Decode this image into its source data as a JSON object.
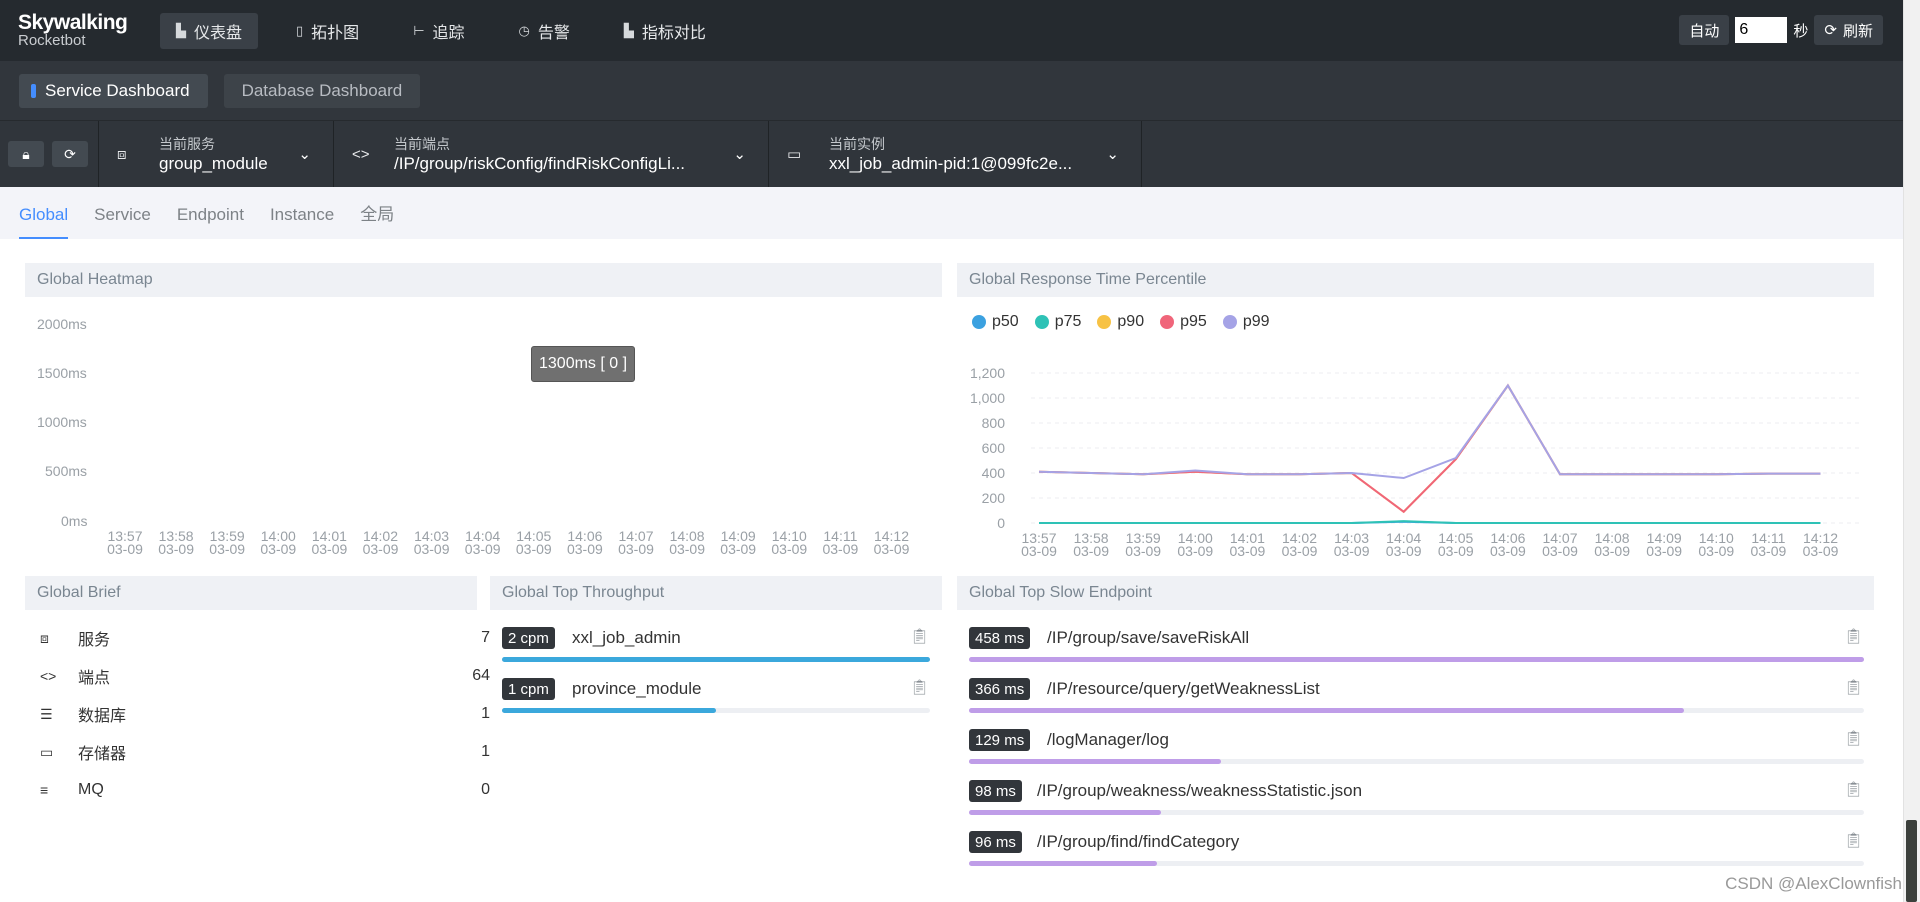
{
  "app": {
    "logo_line1": "Skywalking",
    "logo_line2": "Rocketbot"
  },
  "nav": [
    {
      "icon": "chart-icon",
      "label": "仪表盘",
      "active": true
    },
    {
      "icon": "topology-icon",
      "label": "拓扑图"
    },
    {
      "icon": "trace-icon",
      "label": "追踪"
    },
    {
      "icon": "alarm-icon",
      "label": "告警"
    },
    {
      "icon": "compare-icon",
      "label": "指标对比"
    }
  ],
  "topright": {
    "auto_label": "自动",
    "interval_value": "6",
    "sec_label": "秒",
    "refresh_label": "刷新"
  },
  "dashboards": [
    "Service Dashboard",
    "Database Dashboard"
  ],
  "selectors": {
    "service": {
      "label": "当前服务",
      "value": "group_module"
    },
    "endpoint": {
      "label": "当前端点",
      "value": "/IP/group/riskConfig/findRiskConfigLi..."
    },
    "instance": {
      "label": "当前实例",
      "value": "xxl_job_admin-pid:1@099fc2e..."
    }
  },
  "subtabs": [
    "Global",
    "Service",
    "Endpoint",
    "Instance",
    "全局"
  ],
  "heatmap": {
    "title": "Global Heatmap",
    "y_labels": [
      "2000ms",
      "1500ms",
      "1000ms",
      "500ms",
      "0ms"
    ],
    "tooltip": "1300ms [ 0 ]"
  },
  "time_labels": [
    "13:57",
    "13:58",
    "13:59",
    "14:00",
    "14:01",
    "14:02",
    "14:03",
    "14:04",
    "14:05",
    "14:06",
    "14:07",
    "14:08",
    "14:09",
    "14:10",
    "14:11",
    "14:12"
  ],
  "date_label": "03-09",
  "percentile": {
    "title": "Global Response Time Percentile",
    "y_labels": [
      "1,200",
      "1,000",
      "800",
      "600",
      "400",
      "200",
      "0"
    ],
    "colors": {
      "p50": "#3ba1e0",
      "p75": "#2ec2b6",
      "p90": "#f7c244",
      "p95": "#f0657a",
      "p99": "#a5a3e6"
    }
  },
  "chart_data": {
    "type": "line",
    "title": "Global Response Time Percentile",
    "categories": [
      "13:57",
      "13:58",
      "13:59",
      "14:00",
      "14:01",
      "14:02",
      "14:03",
      "14:04",
      "14:05",
      "14:06",
      "14:07",
      "14:08",
      "14:09",
      "14:10",
      "14:11",
      "14:12"
    ],
    "ylim": [
      0,
      1200
    ],
    "series": [
      {
        "name": "p50",
        "values": [
          0,
          0,
          0,
          0,
          0,
          0,
          0,
          10,
          0,
          0,
          0,
          0,
          0,
          0,
          0,
          0
        ]
      },
      {
        "name": "p75",
        "values": [
          0,
          0,
          0,
          0,
          0,
          0,
          0,
          15,
          0,
          0,
          0,
          0,
          0,
          0,
          0,
          0
        ]
      },
      {
        "name": "p90",
        "values": [
          410,
          400,
          390,
          410,
          390,
          390,
          400,
          90,
          510,
          1100,
          390,
          390,
          390,
          390,
          395,
          395
        ]
      },
      {
        "name": "p95",
        "values": [
          410,
          400,
          390,
          410,
          390,
          390,
          400,
          90,
          510,
          1100,
          390,
          390,
          390,
          390,
          395,
          395
        ]
      },
      {
        "name": "p99",
        "values": [
          410,
          400,
          390,
          420,
          390,
          390,
          400,
          360,
          520,
          1100,
          390,
          390,
          390,
          390,
          395,
          395
        ]
      }
    ]
  },
  "brief": {
    "title": "Global Brief",
    "items": [
      {
        "icon": "service-icon",
        "name": "服务",
        "value": "7"
      },
      {
        "icon": "endpoint-icon",
        "name": "端点",
        "value": "64"
      },
      {
        "icon": "database-icon",
        "name": "数据库",
        "value": "1"
      },
      {
        "icon": "storage-icon",
        "name": "存储器",
        "value": "1"
      },
      {
        "icon": "mq-icon",
        "name": "MQ",
        "value": "0"
      }
    ]
  },
  "throughput": {
    "title": "Global Top Throughput",
    "color": "#3ba8dc",
    "items": [
      {
        "badge": "2 cpm",
        "name": "xxl_job_admin",
        "value": 2
      },
      {
        "badge": "1 cpm",
        "name": "province_module",
        "value": 1
      }
    ]
  },
  "slow": {
    "title": "Global Top Slow Endpoint",
    "color": "#bf9de8",
    "items": [
      {
        "badge": "458 ms",
        "name": "/IP/group/save/saveRiskAll",
        "value": 458
      },
      {
        "badge": "366 ms",
        "name": "/IP/resource/query/getWeaknessList",
        "value": 366
      },
      {
        "badge": "129 ms",
        "name": "/logManager/log",
        "value": 129
      },
      {
        "badge": "98 ms",
        "name": "/IP/group/weakness/weaknessStatistic.json",
        "value": 98
      },
      {
        "badge": "96 ms",
        "name": "/IP/group/find/findCategory",
        "value": 96
      }
    ]
  },
  "watermark": "CSDN @AlexClownfish"
}
